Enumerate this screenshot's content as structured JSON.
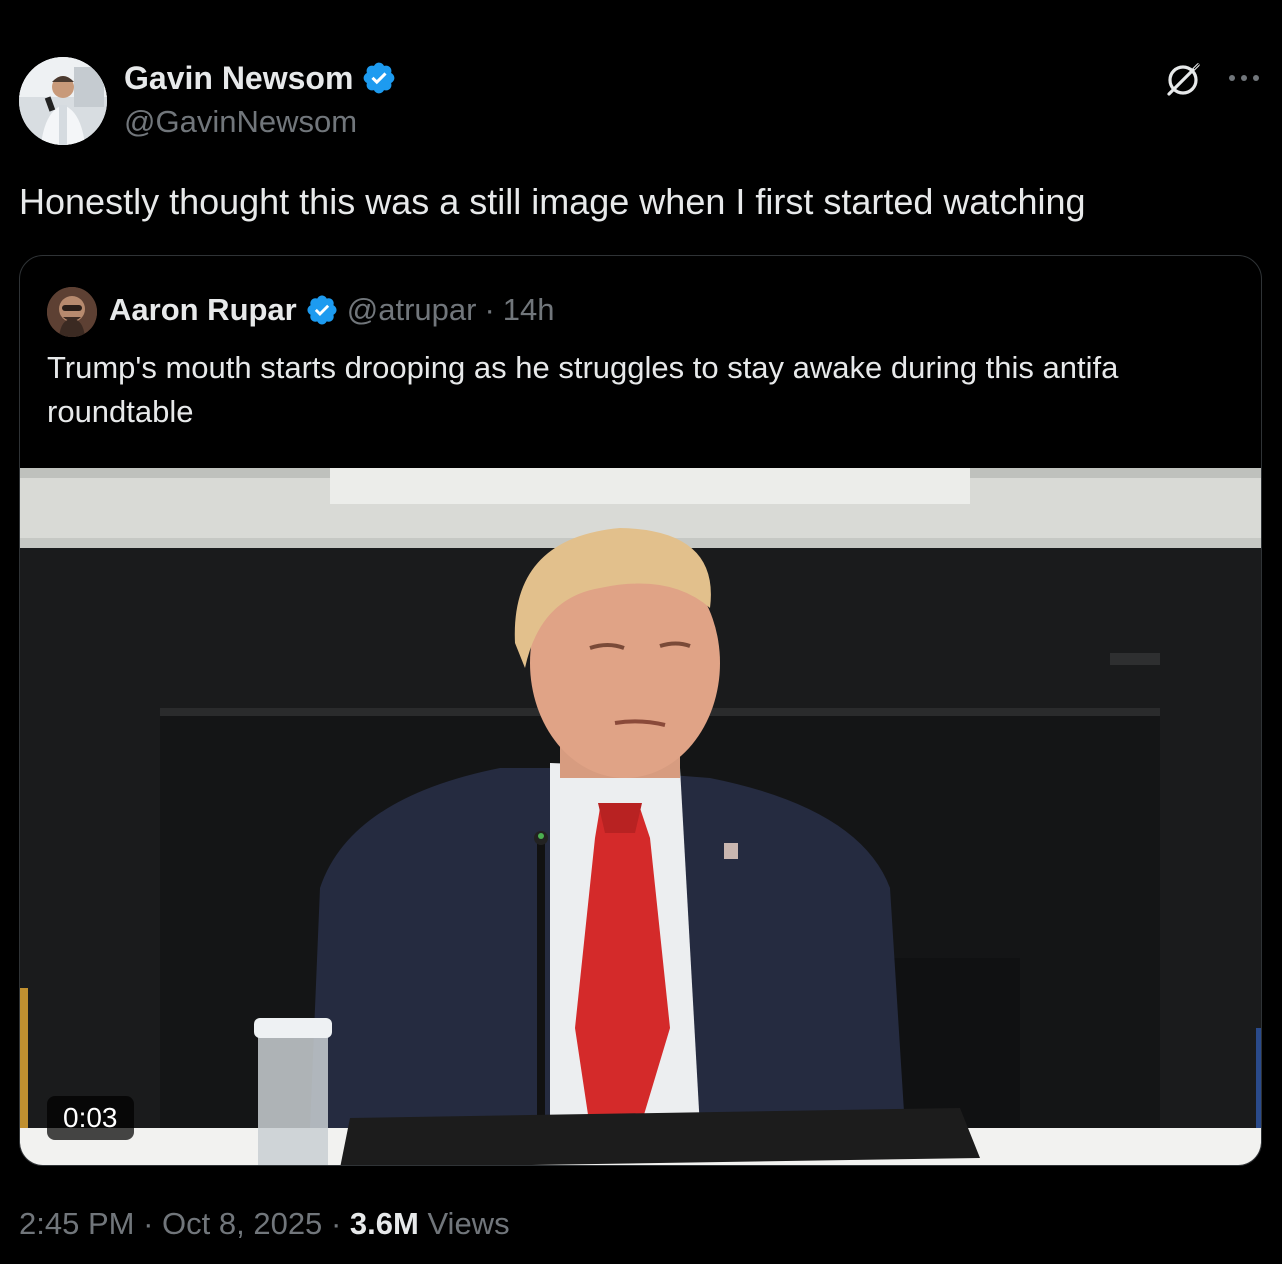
{
  "author": {
    "name": "Gavin Newsom",
    "handle": "@GavinNewsom",
    "avatar_icon": "profile-photo",
    "verified_color": "#1d9bf0"
  },
  "tweet": {
    "text": "Honestly thought this was a still image when I first started watching"
  },
  "quoted": {
    "name": "Aaron Rupar",
    "handle": "@atrupar",
    "separator": "·",
    "time": "14h",
    "text": "Trump's mouth starts drooping as he struggles to stay awake during this antifa roundtable",
    "video_duration": "0:03"
  },
  "footer": {
    "time": "2:45 PM",
    "sep1": "·",
    "date": "Oct 8, 2025",
    "sep2": "·",
    "views_count": "3.6M",
    "views_label": "Views"
  },
  "icons": {
    "grok": "grok-icon",
    "more": "more-options-icon",
    "verified": "verified-badge-icon"
  }
}
